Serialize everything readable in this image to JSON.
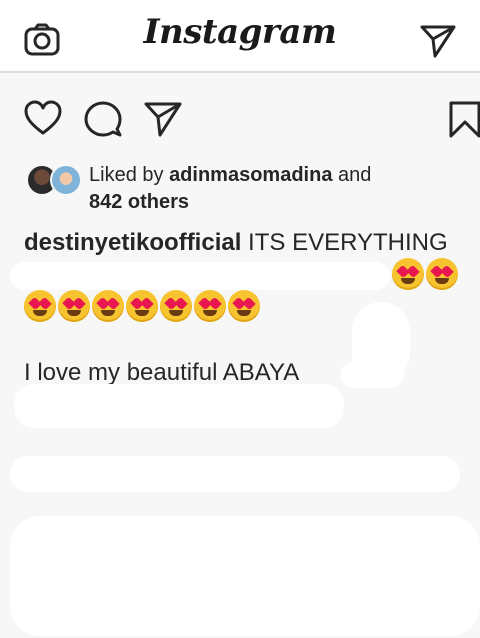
{
  "header": {
    "title": "Instagram",
    "left_icon": "camera-icon",
    "right_icon": "direct-send-icon"
  },
  "actions": {
    "icons": [
      "heart-icon",
      "comment-icon",
      "share-icon",
      "bookmark-icon"
    ]
  },
  "likes": {
    "prefix": "Liked by ",
    "user": "adinmasomadina",
    "conjunction": " and",
    "count_text": "842 others"
  },
  "post": {
    "username": "destinyetikoofficial",
    "caption_line1": " ITS EVERYTHING",
    "emoji_row1_count": 2,
    "emoji_row2_count": 7,
    "emoji_name": "heart-eyes-emoji",
    "caption_line2": "I love my beautiful ABAYA"
  },
  "colors": {
    "text": "#262626",
    "background": "#f7f7f7",
    "header_bg": "#ffffff",
    "heart_eyes": "#e8174f",
    "emoji_face": "#f7c32e"
  }
}
